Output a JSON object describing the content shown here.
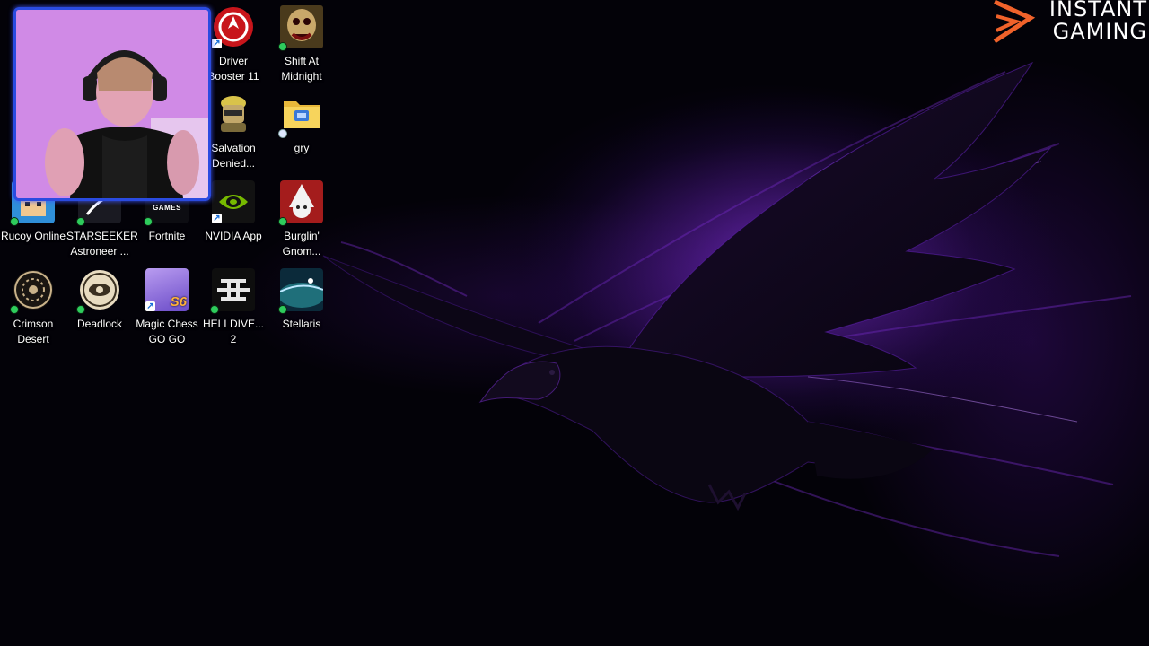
{
  "brand": {
    "line1": "INSTANT",
    "line2": "GAMING",
    "accent": "#f0622a"
  },
  "desktop_icons": [
    {
      "label": "Driver\nBooster 11",
      "icon": "driver-booster-icon",
      "sync": false,
      "shortcut": true
    },
    {
      "label": "Shift At\nMidnight",
      "icon": "shift-at-midnight-icon",
      "sync": true,
      "shortcut": false
    },
    {
      "label": "Salvation\nDenied...",
      "icon": "salvation-denied-icon",
      "sync": false,
      "shortcut": false
    },
    {
      "label": "gry",
      "icon": "folder-icon",
      "sync": true,
      "shortcut": false
    },
    {
      "label": "Rucoy Online",
      "icon": "rucoy-online-icon",
      "sync": true,
      "shortcut": false
    },
    {
      "label": "STARSEEKER\nAstroneer ...",
      "icon": "starseeker-icon",
      "sync": true,
      "shortcut": false
    },
    {
      "label": "Fortnite",
      "icon": "fortnite-icon",
      "badge": "GAMES",
      "sync": true,
      "shortcut": false
    },
    {
      "label": "NVIDIA App",
      "icon": "nvidia-icon",
      "sync": false,
      "shortcut": true
    },
    {
      "label": "Burglin'\nGnom...",
      "icon": "burglin-gnomes-icon",
      "sync": true,
      "shortcut": false
    },
    {
      "label": "Crimson\nDesert",
      "icon": "crimson-desert-icon",
      "sync": true,
      "shortcut": false
    },
    {
      "label": "Deadlock",
      "icon": "deadlock-icon",
      "sync": true,
      "shortcut": false
    },
    {
      "label": "Magic Chess\nGO GO",
      "icon": "magic-chess-icon",
      "badge": "S6",
      "sync": false,
      "shortcut": true
    },
    {
      "label": "HELLDIVE...\n2",
      "icon": "helldivers-icon",
      "sync": true,
      "shortcut": false
    },
    {
      "label": "Stellaris",
      "icon": "stellaris-icon",
      "sync": true,
      "shortcut": false
    }
  ],
  "webcam": {
    "icon": "webcam-overlay",
    "border_color": "#2a4be0"
  },
  "wallpaper": {
    "subject": "raven-icon",
    "glow_color": "#7a2cd8"
  }
}
